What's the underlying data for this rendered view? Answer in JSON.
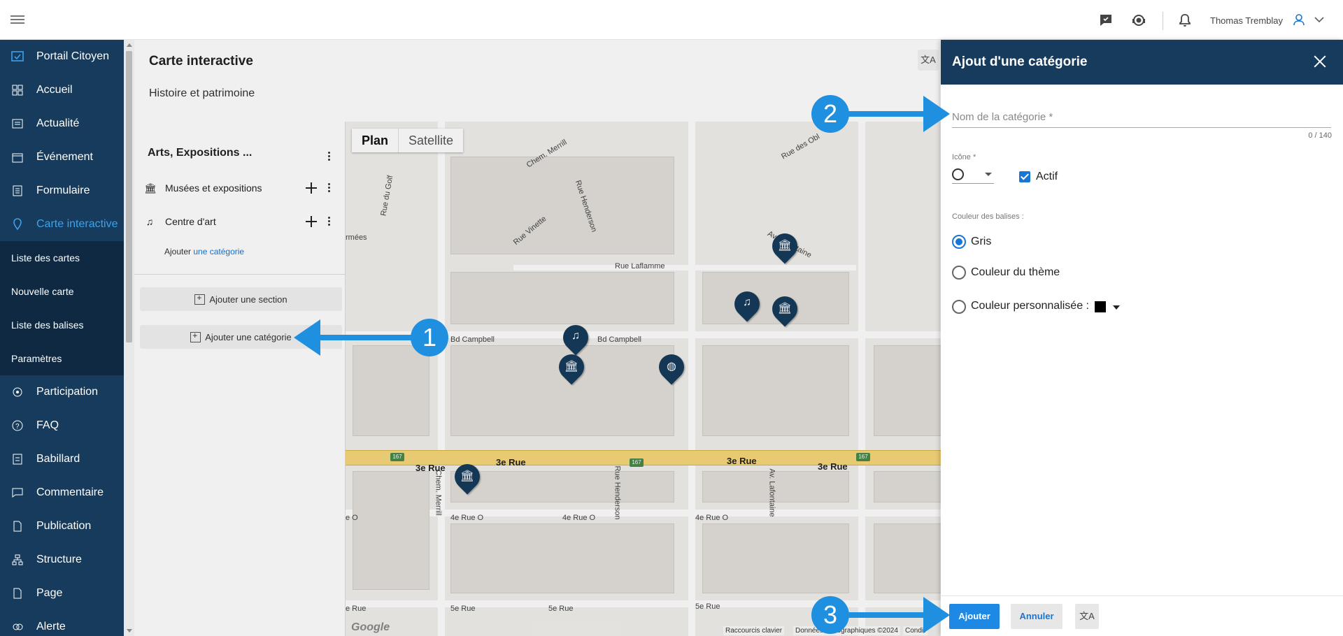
{
  "topbar": {
    "user_name": "Thomas Tremblay"
  },
  "sidebar": {
    "items": [
      {
        "label": "Portail Citoyen",
        "icon": "portal-icon"
      },
      {
        "label": "Accueil",
        "icon": "dashboard-icon"
      },
      {
        "label": "Actualité",
        "icon": "news-icon"
      },
      {
        "label": "Événement",
        "icon": "calendar-icon"
      },
      {
        "label": "Formulaire",
        "icon": "form-icon"
      },
      {
        "label": "Carte interactive",
        "icon": "map-pin-icon"
      },
      {
        "label": "Participation",
        "icon": "participation-icon"
      },
      {
        "label": "FAQ",
        "icon": "help-icon"
      },
      {
        "label": "Babillard",
        "icon": "board-icon"
      },
      {
        "label": "Commentaire",
        "icon": "comment-icon"
      },
      {
        "label": "Publication",
        "icon": "publication-icon"
      },
      {
        "label": "Structure",
        "icon": "structure-icon"
      },
      {
        "label": "Page",
        "icon": "page-icon"
      },
      {
        "label": "Alerte",
        "icon": "alert-icon"
      }
    ],
    "sub_items": [
      "Liste des cartes",
      "Nouvelle carte",
      "Liste des balises",
      "Paramètres"
    ]
  },
  "main": {
    "title": "Carte interactive",
    "subtitle": "Histoire et patrimoine"
  },
  "panel": {
    "section_title": "Arts, Expositions ...",
    "categories": [
      {
        "label": "Musées et expositions",
        "icon": "museum-icon"
      },
      {
        "label": "Centre d'art",
        "icon": "music-note-icon"
      }
    ],
    "add_prefix": "Ajouter",
    "add_link": "une catégorie",
    "add_section": "Ajouter une section",
    "add_category": "Ajouter une catégorie"
  },
  "map": {
    "toggle_plan": "Plan",
    "toggle_satellite": "Satellite",
    "streets": [
      "Chem. Merrill",
      "Rue du Golf",
      "Rue des Obl",
      "Rue Henderson",
      "Rue Vinette",
      "Rue Laflamme",
      "Av. Lafontaine",
      "Bd Campbell",
      "Bd Campbell",
      "3e Rue",
      "3e Rue",
      "3e Rue",
      "3e Rue",
      "4e Rue O",
      "4e Rue O",
      "4e Rue O",
      "5e Rue",
      "5e Rue",
      "5e Rue",
      "e O",
      "e Rue",
      "rmées",
      "Chem. Merrill",
      "Rue Henderson",
      "Av. Lafontaine"
    ],
    "shield": "167",
    "footer_shortcuts": "Raccourcis clavier",
    "footer_data": "Données cartographiques ©2024",
    "footer_cond": "Condit",
    "google": "Google"
  },
  "dialog": {
    "title": "Ajout d'une catégorie",
    "name_placeholder": "Nom de la catégorie *",
    "counter": "0 / 140",
    "icon_label": "Icône *",
    "active_label": "Actif",
    "color_label": "Couleur des balises :",
    "options": [
      "Gris",
      "Couleur du thème",
      "Couleur personnalisée :"
    ],
    "selected_option": "Gris",
    "custom_color": "#000000",
    "btn_add": "Ajouter",
    "btn_cancel": "Annuler"
  },
  "annotations": [
    "1",
    "2",
    "3"
  ],
  "colors": {
    "sidebar": "#163b5c",
    "accent": "#1976d2",
    "annotation": "#1f8fe0"
  }
}
